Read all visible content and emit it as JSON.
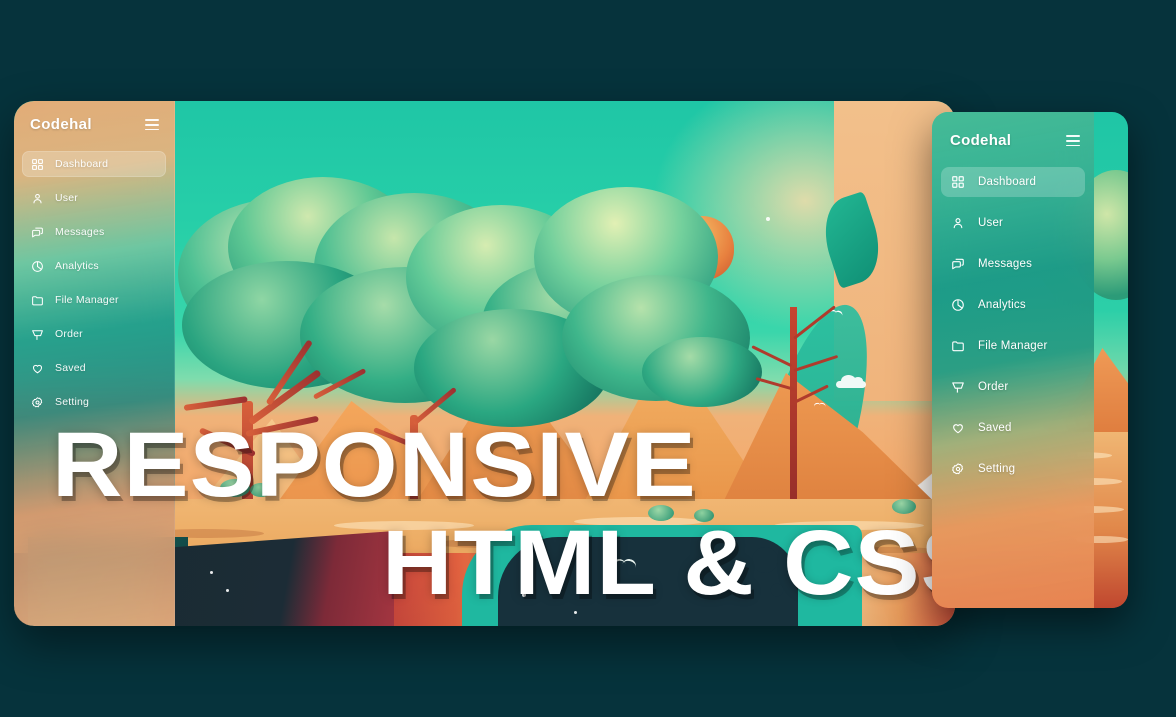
{
  "theme": {
    "page_background": "#06333c",
    "accent_teal": "#1fc6a6",
    "accent_orange": "#ef9a56",
    "text_on_sidebar": "#ffffff",
    "active_item_background": "rgba(255,255,255,0.22)"
  },
  "headline": {
    "line1": "RESPONSIVE",
    "line2": "HTML & CSS"
  },
  "desktop": {
    "brand": "Codehal",
    "menu_icon": "hamburger-icon",
    "nav": [
      {
        "label": "Dashboard",
        "icon": "grid-icon",
        "active": true
      },
      {
        "label": "User",
        "icon": "user-icon",
        "active": false
      },
      {
        "label": "Messages",
        "icon": "chat-icon",
        "active": false
      },
      {
        "label": "Analytics",
        "icon": "pie-chart-icon",
        "active": false
      },
      {
        "label": "File Manager",
        "icon": "folder-icon",
        "active": false
      },
      {
        "label": "Order",
        "icon": "cart-icon",
        "active": false
      },
      {
        "label": "Saved",
        "icon": "heart-icon",
        "active": false
      },
      {
        "label": "Setting",
        "icon": "gear-icon",
        "active": false
      }
    ]
  },
  "mobile": {
    "brand": "Codehal",
    "menu_icon": "hamburger-icon",
    "nav": [
      {
        "label": "Dashboard",
        "icon": "grid-icon",
        "active": true
      },
      {
        "label": "User",
        "icon": "user-icon",
        "active": false
      },
      {
        "label": "Messages",
        "icon": "chat-icon",
        "active": false
      },
      {
        "label": "Analytics",
        "icon": "pie-chart-icon",
        "active": false
      },
      {
        "label": "File Manager",
        "icon": "folder-icon",
        "active": false
      },
      {
        "label": "Order",
        "icon": "cart-icon",
        "active": false
      },
      {
        "label": "Saved",
        "icon": "heart-icon",
        "active": false
      },
      {
        "label": "Setting",
        "icon": "gear-icon",
        "active": false
      }
    ]
  },
  "illustration": {
    "description": "Stylized desert landscape with teal acacia trees, orange mountains, hot air balloon, birds, clouds and a teal lagoon"
  }
}
